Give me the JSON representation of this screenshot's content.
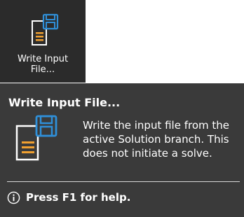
{
  "ribbon_button": {
    "label_line1": "Write Input",
    "label_line2": "File...",
    "icon": "write-input-file-icon"
  },
  "tooltip": {
    "title": "Write Input File...",
    "description_lines": [
      "Write the input file from the",
      "active Solution branch. This",
      "does not initiate a solve."
    ],
    "icon": "write-input-file-icon",
    "help_icon": "info-icon",
    "help_text": "Press F1 for help."
  },
  "colors": {
    "ribbon_bg": "#2b2b2b",
    "tooltip_bg": "#3a3a3a",
    "text": "#ffffff",
    "document_orange": "#f0a030",
    "disk_blue": "#2f8fd8"
  }
}
